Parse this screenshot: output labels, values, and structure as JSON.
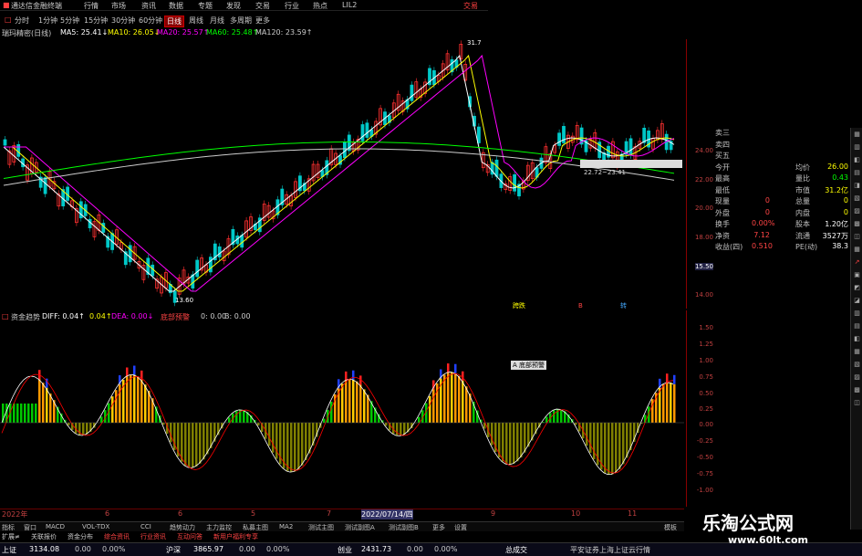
{
  "app": {
    "title": "通达信金融终端",
    "menu": [
      "行情",
      "市场",
      "资讯",
      "数据",
      "专题",
      "发现",
      "交易",
      "行业",
      "热点",
      "LIL2"
    ],
    "right_menu": "交易"
  },
  "periods": [
    "分时",
    "1分钟",
    "5分钟",
    "15分钟",
    "30分钟",
    "60分钟",
    "日线",
    "周线",
    "月线",
    "多周期",
    "更多"
  ],
  "active_period": "日线",
  "ma": {
    "name": "瑞玛精密(日线)",
    "items": [
      {
        "label": "MA5: 25.41↓",
        "color": "#ffffff"
      },
      {
        "label": "MA10: 26.05↓",
        "color": "#ffff00"
      },
      {
        "label": "MA20: 25.57↑",
        "color": "#ff00ff"
      },
      {
        "label": "MA60: 25.48↑",
        "color": "#00ff00"
      },
      {
        "label": "MA120: 23.59↑",
        "color": "#cccccc"
      }
    ]
  },
  "main_chart": {
    "high_label": "31.7",
    "low_label": "13.60",
    "range_label": "22.72~23.41",
    "tags": [
      "跨跌",
      "B",
      "转"
    ]
  },
  "price_axis": [
    "24.00",
    "22.00",
    "20.00",
    "18.00",
    "16.00",
    "14.00"
  ],
  "price_tag": "15.50",
  "indicator": {
    "title": "资金趋势",
    "diff": "DIFF: 0.04↑",
    "d2": "0.04↑",
    "dea": "DEA: 0.00↓",
    "red": "底部预警",
    "b": "0: 0.00",
    "b2": "B: 0.00",
    "label_box": "A 底部预警"
  },
  "ind_axis": [
    "1.50",
    "1.25",
    "1.00",
    "0.75",
    "0.50",
    "0.25",
    "0.00",
    "-0.25",
    "-0.50",
    "-0.75",
    "-1.00"
  ],
  "quote": {
    "rows": [
      {
        "l": "卖三",
        "v": "",
        "l2": "",
        "v2": ""
      },
      {
        "l": "卖四",
        "v": "",
        "l2": "",
        "v2": ""
      },
      {
        "l": "买五",
        "v": "",
        "l2": "",
        "v2": ""
      },
      {
        "l": "今开",
        "v": "",
        "l2": "均价",
        "v2": "26.00"
      },
      {
        "l": "最高",
        "v": "",
        "l2": "量比",
        "v2": "0.43"
      },
      {
        "l": "最低",
        "v": "",
        "l2": "市值",
        "v2": "31.2亿"
      },
      {
        "l": "现量",
        "v": "0",
        "l2": "总量",
        "v2": "0"
      },
      {
        "l": "外盘",
        "v": "0",
        "l2": "内盘",
        "v2": "0"
      },
      {
        "l": "换手",
        "v": "0.00%",
        "l2": "股本",
        "v2": "1.20亿"
      },
      {
        "l": "净资",
        "v": "7.12",
        "l2": "流通",
        "v2": "3527万"
      },
      {
        "l": "收益(四)",
        "v": "0.510",
        "l2": "PE(动)",
        "v2": "38.3"
      }
    ]
  },
  "date_bar": {
    "start": "2022年",
    "mid": "2022/07/14/四",
    "marks": [
      "6",
      "6",
      "5",
      "7",
      "8",
      "9",
      "10",
      "11"
    ]
  },
  "bottom_tabs": [
    "指标",
    "窗口",
    "MACD",
    "VOL-TDX",
    "CCI",
    "趋势动力",
    "主力监控",
    "私募主图",
    "MA2",
    "测试主图",
    "测试副图A",
    "测试副图B",
    "更多",
    "设置"
  ],
  "sub_tabs": [
    "扩展≠",
    "关联报价",
    "资金分布",
    "综合资讯",
    "行业资讯",
    "互动问答",
    "新用户福利专享"
  ],
  "right_label": "模板",
  "status": {
    "sh": "上证",
    "sh_v": "3134.08",
    "sh_c": "0.00",
    "sh_p": "0.00%",
    "sz": "沪深",
    "sz_v": "3865.97",
    "sz_c": "0.00",
    "sz_p": "0.00%",
    "cy": "创业",
    "cy_v": "2431.73",
    "cy_c": "0.00",
    "cy_p": "0.00%",
    "cj": "总成交",
    "broker": "平安证券上海上证云行情"
  },
  "watermark": {
    "brand": "乐淘公式网",
    "site": "www.60lt.com"
  }
}
